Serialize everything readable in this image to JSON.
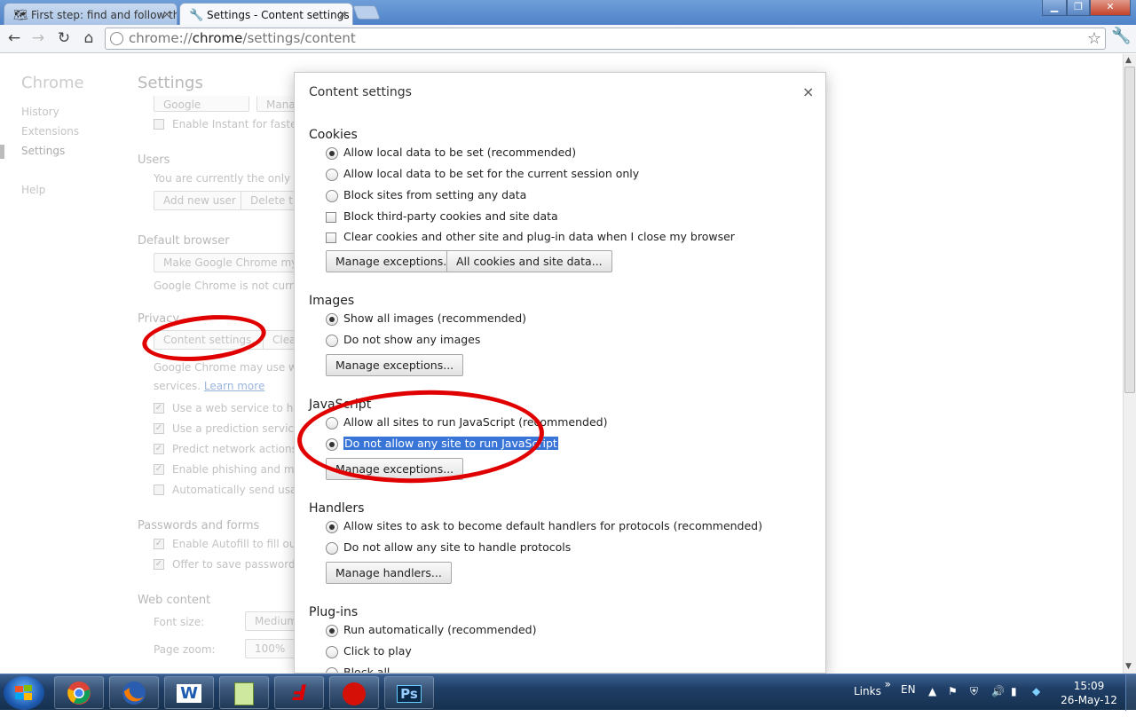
{
  "window": {
    "tabs": [
      {
        "label": "First step: find and follow th",
        "icon": "map-icon",
        "active": false
      },
      {
        "label": "Settings - Content settings",
        "icon": "wrench-icon",
        "active": true
      }
    ]
  },
  "toolbar": {
    "url_scheme": "chrome://",
    "url_host": "chrome",
    "url_path": "/settings/content"
  },
  "background": {
    "brand": "Chrome",
    "sidebar": [
      "History",
      "Extensions",
      "Settings",
      "Help"
    ],
    "title": "Settings",
    "search_engine": "Google",
    "search_btn2": "Mana",
    "instant": "Enable Instant for faster se",
    "users_heading": "Users",
    "users_text": "You are currently the only Goo",
    "add_user": "Add new user",
    "delete_user": "Delete thi",
    "default_browser_heading": "Default browser",
    "make_default": "Make Google Chrome my d",
    "not_default": "Google Chrome is not current",
    "privacy_heading": "Privacy",
    "content_settings_btn": "Content settings...",
    "clear_btn": "Clea",
    "privacy_text1": "Google Chrome may use web",
    "privacy_text2": "services.",
    "learn_more": "Learn more",
    "privacy_checks": [
      {
        "label": "Use a web service to help r",
        "checked": true
      },
      {
        "label": "Use a prediction service to",
        "checked": true
      },
      {
        "label": "Predict network actions to",
        "checked": true
      },
      {
        "label": "Enable phishing and malw",
        "checked": true
      },
      {
        "label": "Automatically send usage",
        "checked": false
      }
    ],
    "passwords_heading": "Passwords and forms",
    "password_checks": [
      {
        "label": "Enable Autofill to fill out w",
        "checked": true
      },
      {
        "label": "Offer to save passwords I e",
        "checked": true
      }
    ],
    "webcontent_heading": "Web content",
    "font_size_label": "Font size:",
    "font_size_value": "Medium",
    "page_zoom_label": "Page zoom:",
    "page_zoom_value": "100%"
  },
  "dialog": {
    "title": "Content settings",
    "close": "×",
    "cookies": {
      "heading": "Cookies",
      "options": [
        {
          "label": "Allow local data to be set (recommended)",
          "selected": true
        },
        {
          "label": "Allow local data to be set for the current session only",
          "selected": false
        },
        {
          "label": "Block sites from setting any data",
          "selected": false
        }
      ],
      "checks": [
        {
          "label": "Block third-party cookies and site data",
          "checked": false
        },
        {
          "label": "Clear cookies and other site and plug-in data when I close my browser",
          "checked": false
        }
      ],
      "btn_exceptions": "Manage exceptions...",
      "btn_all": "All cookies and site data..."
    },
    "images": {
      "heading": "Images",
      "options": [
        {
          "label": "Show all images (recommended)",
          "selected": true
        },
        {
          "label": "Do not show any images",
          "selected": false
        }
      ],
      "btn_exceptions": "Manage exceptions..."
    },
    "javascript": {
      "heading": "JavaScript",
      "options": [
        {
          "label": "Allow all sites to run JavaScript (recommended)",
          "selected": false
        },
        {
          "label": "Do not allow any site to run JavaScript",
          "selected": true
        }
      ],
      "btn_exceptions": "Manage exceptions..."
    },
    "handlers": {
      "heading": "Handlers",
      "options": [
        {
          "label": "Allow sites to ask to become default handlers for protocols (recommended)",
          "selected": true
        },
        {
          "label": "Do not allow any site to handle protocols",
          "selected": false
        }
      ],
      "btn_manage": "Manage handlers..."
    },
    "plugins": {
      "heading": "Plug-ins",
      "options": [
        {
          "label": "Run automatically (recommended)",
          "selected": true
        },
        {
          "label": "Click to play",
          "selected": false
        },
        {
          "label": "Block all",
          "selected": false
        }
      ]
    }
  },
  "taskbar": {
    "apps": [
      "chrome-icon",
      "firefox-icon",
      "word-icon",
      "notepad-plus-icon",
      "app-red-icon",
      "lastfm-icon",
      "photoshop-icon"
    ],
    "word_glyph": "W",
    "ps_glyph": "Ps",
    "links": "Links",
    "chevron": "»",
    "lang": "EN",
    "time": "15:09",
    "date": "26-May-12"
  },
  "colors": {
    "accent_highlight": "#3875d7",
    "annotation_red": "#e00000"
  }
}
